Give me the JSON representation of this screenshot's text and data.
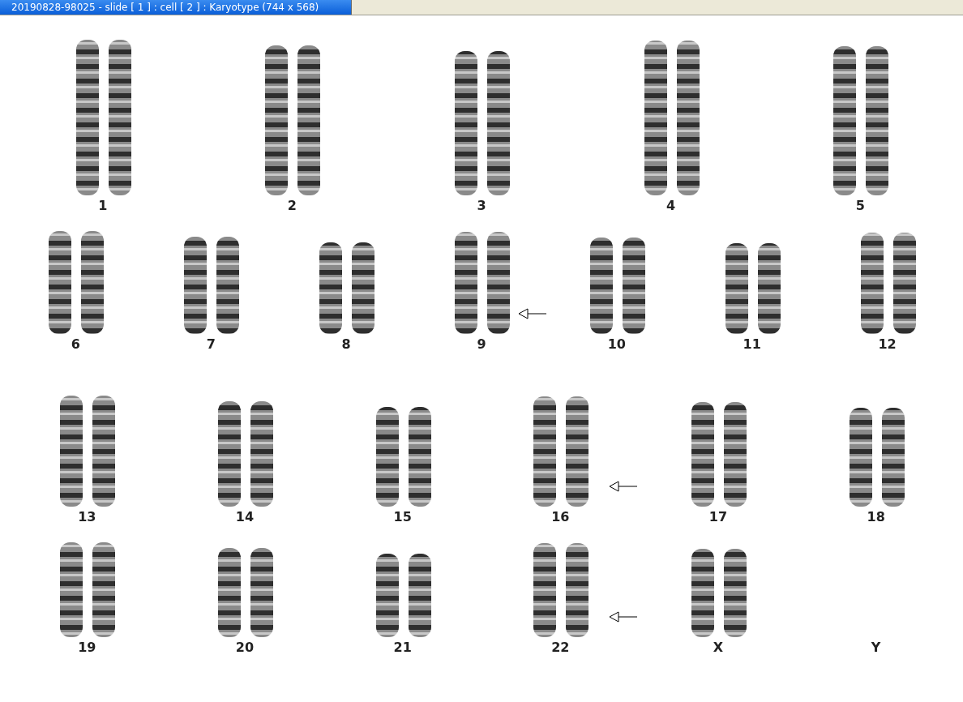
{
  "window": {
    "title": "20190828-98025 - slide [ 1 ] : cell [ 2 ] : Karyotype  (744 x 568)"
  },
  "rows": [
    {
      "chromosomes": [
        {
          "label": "1",
          "kind": "pair",
          "arrow": false
        },
        {
          "label": "2",
          "kind": "pair",
          "arrow": false
        },
        {
          "label": "3",
          "kind": "pair",
          "arrow": false
        },
        {
          "label": "4",
          "kind": "pair",
          "arrow": false
        },
        {
          "label": "5",
          "kind": "pair",
          "arrow": false
        }
      ]
    },
    {
      "chromosomes": [
        {
          "label": "6",
          "kind": "pair",
          "arrow": false
        },
        {
          "label": "7",
          "kind": "pair",
          "arrow": false
        },
        {
          "label": "8",
          "kind": "pair",
          "arrow": false
        },
        {
          "label": "9",
          "kind": "pair",
          "arrow": true
        },
        {
          "label": "10",
          "kind": "pair",
          "arrow": false
        },
        {
          "label": "11",
          "kind": "pair",
          "arrow": false
        },
        {
          "label": "12",
          "kind": "pair",
          "arrow": false
        }
      ]
    },
    {
      "chromosomes": [
        {
          "label": "13",
          "kind": "pair",
          "arrow": false
        },
        {
          "label": "14",
          "kind": "pair",
          "arrow": false
        },
        {
          "label": "15",
          "kind": "pair",
          "arrow": false
        },
        {
          "label": "16",
          "kind": "pair",
          "arrow": true
        },
        {
          "label": "17",
          "kind": "pair",
          "arrow": false
        },
        {
          "label": "18",
          "kind": "pair",
          "arrow": false
        }
      ]
    },
    {
      "chromosomes": [
        {
          "label": "19",
          "kind": "pair",
          "arrow": false
        },
        {
          "label": "20",
          "kind": "pair",
          "arrow": false
        },
        {
          "label": "21",
          "kind": "pair",
          "arrow": false
        },
        {
          "label": "22",
          "kind": "pair",
          "arrow": true
        },
        {
          "label": "X",
          "kind": "pair",
          "arrow": false
        },
        {
          "label": "Y",
          "kind": "empty",
          "arrow": false
        }
      ]
    }
  ]
}
